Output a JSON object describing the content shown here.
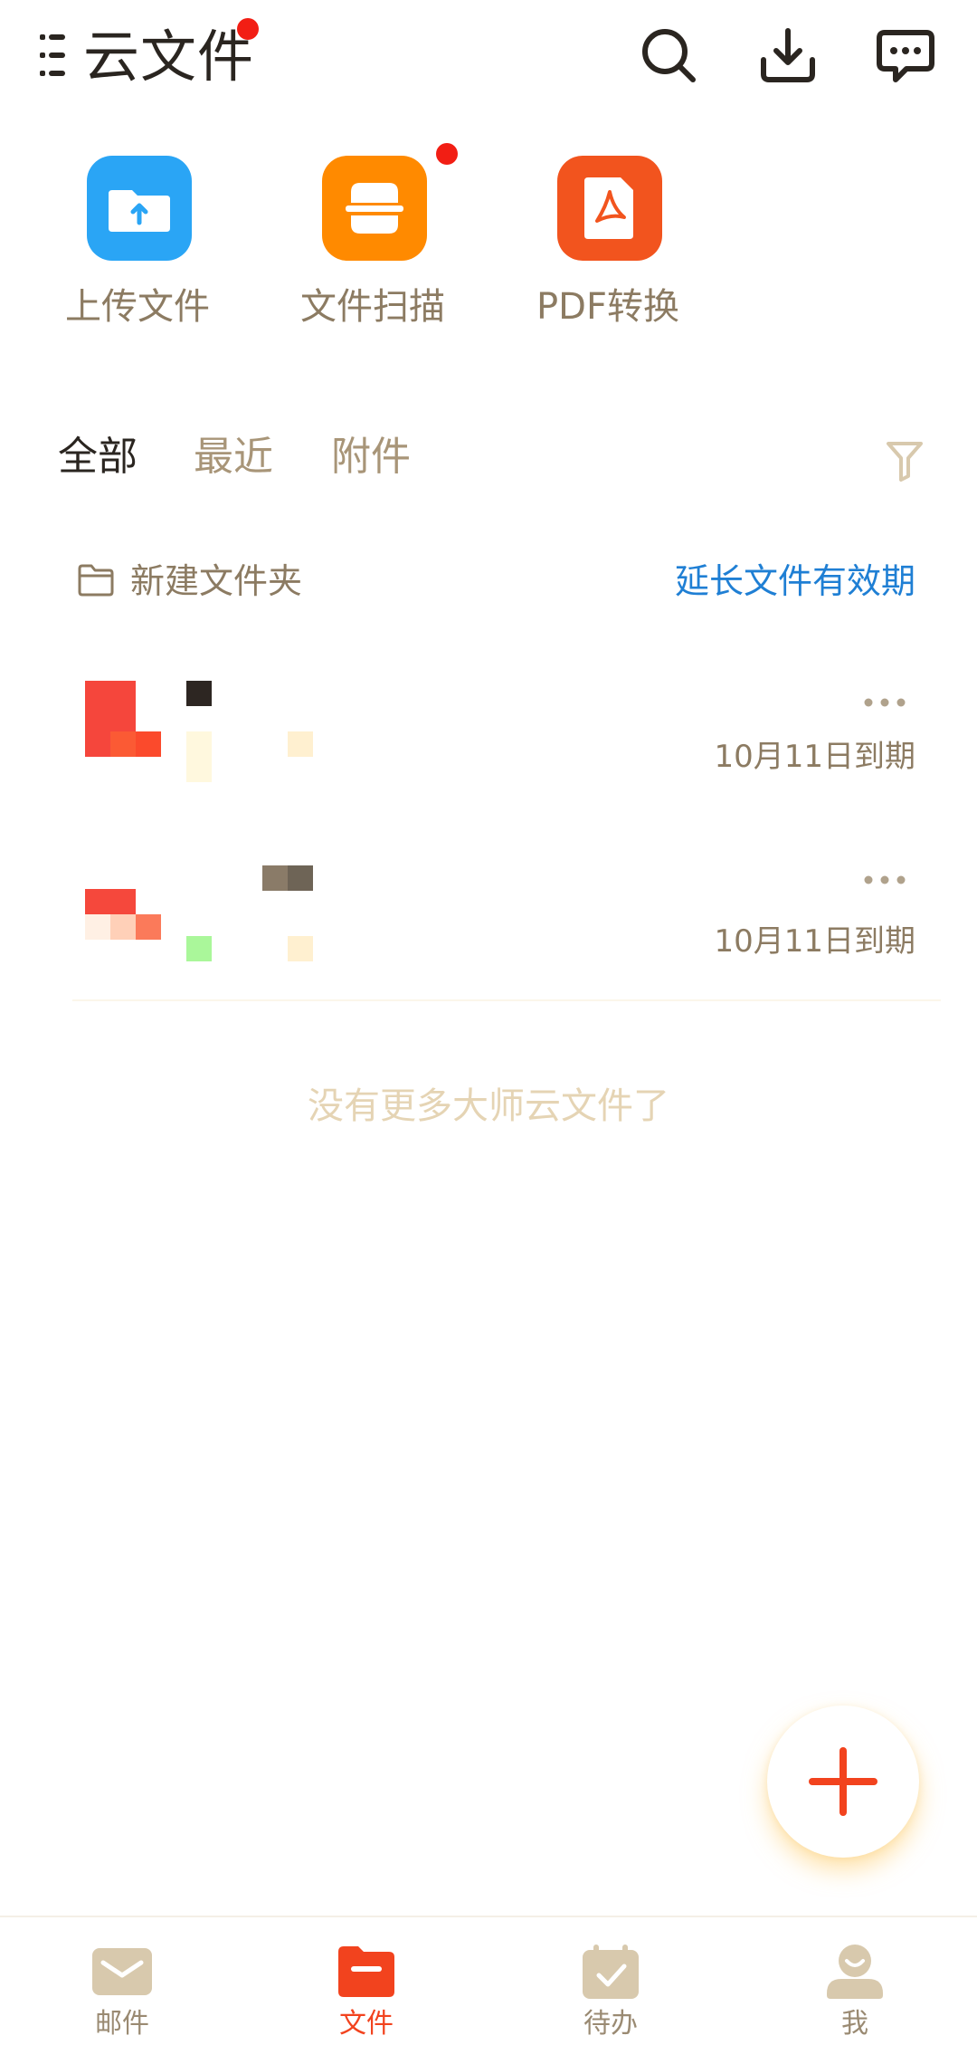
{
  "header": {
    "title": "云文件",
    "icons": [
      "menu-icon",
      "search-icon",
      "download-icon",
      "message-icon"
    ]
  },
  "tools": [
    {
      "label": "上传文件",
      "icon": "upload-folder-icon",
      "color": "#2aa5f5"
    },
    {
      "label": "文件扫描",
      "icon": "scan-icon",
      "color": "#ff8a00"
    },
    {
      "label": "PDF转换",
      "icon": "pdf-icon",
      "color": "#f2541e"
    }
  ],
  "tabs": [
    {
      "label": "全部",
      "active": true
    },
    {
      "label": "最近",
      "active": false
    },
    {
      "label": "附件",
      "active": false
    }
  ],
  "folder_action": {
    "new_folder": "新建文件夹",
    "extend_validity": "延长文件有效期"
  },
  "files": [
    {
      "expire": "10月11日到期"
    },
    {
      "expire": "10月11日到期"
    }
  ],
  "list_footer": "没有更多大师云文件了",
  "bottom_nav": [
    {
      "label": "邮件",
      "icon": "mail-icon",
      "active": false
    },
    {
      "label": "文件",
      "icon": "folder-icon",
      "active": true
    },
    {
      "label": "待办",
      "icon": "calendar-check-icon",
      "active": false
    },
    {
      "label": "我",
      "icon": "profile-icon",
      "active": false
    }
  ],
  "colors": {
    "accent": "#f2431e",
    "link": "#1f7fd4",
    "muted_text": "#8c7b62",
    "badge_red": "#f21e14"
  }
}
